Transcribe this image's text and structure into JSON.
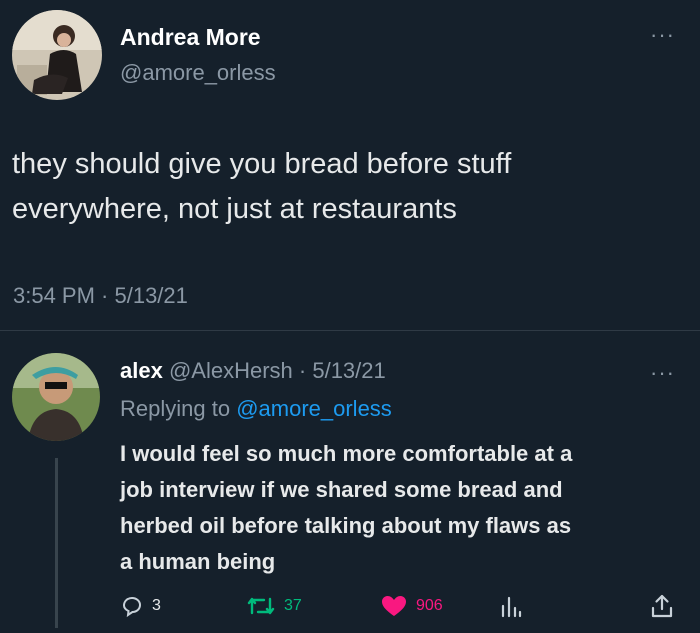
{
  "original": {
    "author": {
      "name": "Andrea More",
      "handle": "@amore_orless"
    },
    "text_lines": [
      "they should give you bread before stuff",
      "everywhere, not just at restaurants"
    ],
    "timestamp": "3:54 PM · 5/13/21",
    "more_icon": "more-icon"
  },
  "reply": {
    "author_name": "alex",
    "author_handle": "@AlexHersh",
    "separator": " · ",
    "date": "5/13/21",
    "replying_prefix": "Replying to ",
    "replying_handle": "@amore_orless",
    "text_lines": [
      "I would feel so much more comfortable at a",
      "job interview if we shared some bread and",
      "herbed oil before talking about my flaws as",
      "a human being"
    ],
    "actions": {
      "reply_count": "3",
      "retweet_count": "37",
      "like_count": "906"
    }
  },
  "colors": {
    "background": "#15202b",
    "text": "#e7e9ea",
    "muted": "#8b98a5",
    "link": "#1d9bf0",
    "retweet": "#00ba7c",
    "like": "#f91880"
  }
}
